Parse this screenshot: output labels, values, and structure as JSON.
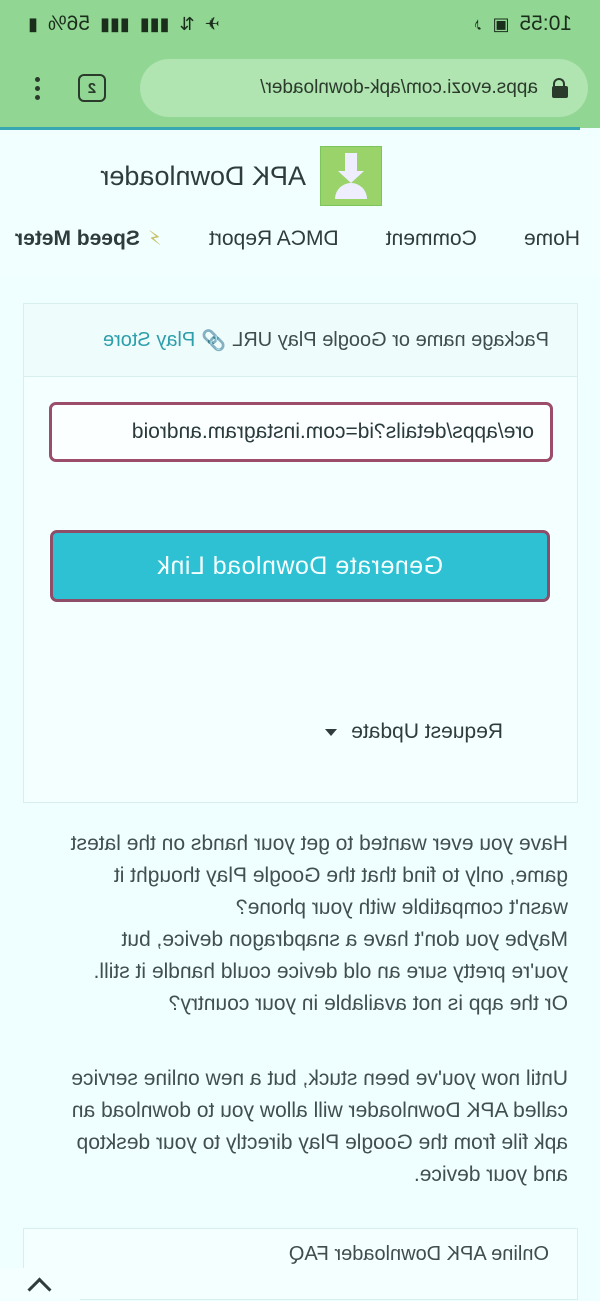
{
  "statusbar": {
    "time": "10:55",
    "battery": "56%"
  },
  "browser": {
    "url": "apps.evozi.com/apk-downloader/",
    "tab_count": "2"
  },
  "site": {
    "title": "APK Downloader",
    "nav": [
      "Home",
      "Comment",
      "DMCA Report",
      "Speed Meter"
    ]
  },
  "form": {
    "label_prefix": "Package name or Google Play URL",
    "label_link": "Play Store",
    "input_value": "ore/apps/details?id=com.instagram.android",
    "button_label": "Generate Download Link",
    "request_update": "Request Update"
  },
  "article": {
    "p1_lines": [
      "Have you ever wanted to get your hands on the latest",
      "game, only to find that the Google Play thought it",
      "wasn't compatible with your phone?",
      "Maybe you don't have a snapdragon device, but",
      "you're pretty sure an old device could handle it still.",
      "Or the app is not available in your country?"
    ],
    "p2_lines": [
      "Until now you've been stuck, but a new online service",
      "called APK Downloader will allow you to download an",
      "apk file from the Google Play directly to your desktop",
      "and your device."
    ]
  },
  "faq": {
    "title": "Online APK Downloader FAQ"
  }
}
